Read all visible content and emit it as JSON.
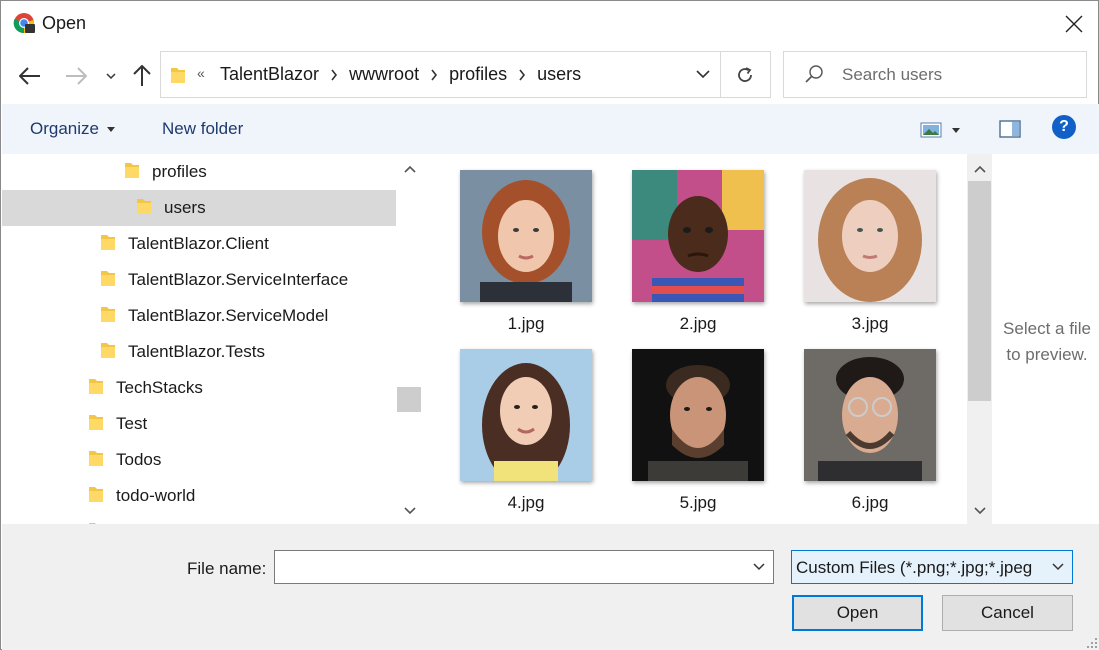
{
  "window": {
    "title": "Open",
    "app_icon": "chrome-icon"
  },
  "nav": {
    "back_icon": "arrow-left-icon",
    "forward_icon": "arrow-right-icon",
    "recent_icon": "chevron-down-icon",
    "up_icon": "arrow-up-icon"
  },
  "address": {
    "overflow": "«",
    "crumbs": [
      "TalentBlazor",
      "wwwroot",
      "profiles",
      "users"
    ]
  },
  "search": {
    "placeholder": "Search users"
  },
  "toolbar": {
    "organize_label": "Organize",
    "new_folder_label": "New folder",
    "help_label": "?"
  },
  "tree": {
    "items": [
      {
        "label": "profiles"
      },
      {
        "label": "users",
        "selected": true
      },
      {
        "label": "TalentBlazor.Client"
      },
      {
        "label": "TalentBlazor.ServiceInterface"
      },
      {
        "label": "TalentBlazor.ServiceModel"
      },
      {
        "label": "TalentBlazor.Tests"
      },
      {
        "label": "TechStacks"
      },
      {
        "label": "Test"
      },
      {
        "label": "Todos"
      },
      {
        "label": "todo-world"
      }
    ]
  },
  "files": [
    {
      "name": "1.jpg"
    },
    {
      "name": "2.jpg"
    },
    {
      "name": "3.jpg"
    },
    {
      "name": "4.jpg"
    },
    {
      "name": "5.jpg"
    },
    {
      "name": "6.jpg"
    }
  ],
  "preview": {
    "line1": "Select a file",
    "line2": "to preview."
  },
  "bottom": {
    "filename_label": "File name:",
    "filename_value": "",
    "filetype_value": "Custom Files (*.png;*.jpg;*.jpeg",
    "open_label": "Open",
    "cancel_label": "Cancel"
  },
  "colors": {
    "accent": "#0078d7",
    "folder": "#f3c646",
    "selected_row": "#d9d9d9",
    "cmdbar": "#f0f5fb"
  }
}
